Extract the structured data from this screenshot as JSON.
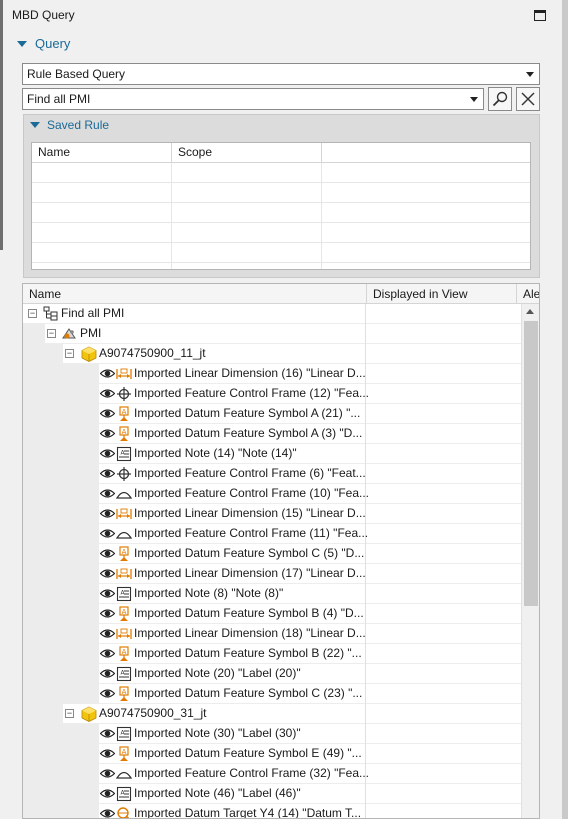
{
  "panel": {
    "title": "MBD Query"
  },
  "query": {
    "section_label": "Query",
    "type_value": "Rule Based Query",
    "rule_value": "Find all PMI"
  },
  "saved_rule": {
    "section_label": "Saved Rule",
    "columns": [
      "Name",
      "Scope"
    ],
    "rows": []
  },
  "results": {
    "columns": [
      "Name",
      "Displayed in View",
      "Ale"
    ],
    "root": "Find all PMI",
    "group": "PMI",
    "parts": [
      {
        "name": "A9074750900_11_jt",
        "items": [
          {
            "icon": "linear-dimension",
            "label": "Imported Linear Dimension (16) \"Linear D..."
          },
          {
            "icon": "feature-control-frame",
            "label": "Imported Feature Control Frame (12) \"Fea..."
          },
          {
            "icon": "datum-feature-symbol",
            "label": "Imported Datum Feature Symbol A (21) \"..."
          },
          {
            "icon": "datum-feature-symbol",
            "label": "Imported Datum Feature Symbol A (3) \"D..."
          },
          {
            "icon": "note",
            "label": "Imported Note (14) \"Note (14)\""
          },
          {
            "icon": "feature-control-frame",
            "label": "Imported Feature Control Frame (6) \"Feat..."
          },
          {
            "icon": "profile-control-frame",
            "label": "Imported Feature Control Frame (10) \"Fea..."
          },
          {
            "icon": "linear-dimension",
            "label": "Imported Linear Dimension (15) \"Linear D..."
          },
          {
            "icon": "profile-control-frame",
            "label": "Imported Feature Control Frame (11) \"Fea..."
          },
          {
            "icon": "datum-feature-symbol",
            "label": "Imported Datum Feature Symbol C (5) \"D..."
          },
          {
            "icon": "linear-dimension",
            "label": "Imported Linear Dimension (17) \"Linear D..."
          },
          {
            "icon": "note",
            "label": "Imported Note (8) \"Note (8)\""
          },
          {
            "icon": "datum-feature-symbol",
            "label": "Imported Datum Feature Symbol B (4) \"D..."
          },
          {
            "icon": "linear-dimension",
            "label": "Imported Linear Dimension (18) \"Linear D..."
          },
          {
            "icon": "datum-feature-symbol",
            "label": "Imported Datum Feature Symbol B (22) \"..."
          },
          {
            "icon": "note",
            "label": "Imported Note (20) \"Label (20)\""
          },
          {
            "icon": "datum-feature-symbol",
            "label": "Imported Datum Feature Symbol C (23) \"..."
          }
        ]
      },
      {
        "name": "A9074750900_31_jt",
        "items": [
          {
            "icon": "note",
            "label": "Imported Note (30) \"Label (30)\""
          },
          {
            "icon": "datum-feature-symbol",
            "label": "Imported Datum Feature Symbol E (49) \"..."
          },
          {
            "icon": "profile-control-frame",
            "label": "Imported Feature Control Frame (32) \"Fea..."
          },
          {
            "icon": "note",
            "label": "Imported Note (46) \"Label (46)\""
          },
          {
            "icon": "datum-target",
            "label": "Imported Datum Target Y4 (14) \"Datum T..."
          }
        ]
      }
    ]
  },
  "colors": {
    "accent": "#1b6a97",
    "icon_orange": "#e07b00",
    "part_yellow": "#e8b400"
  }
}
